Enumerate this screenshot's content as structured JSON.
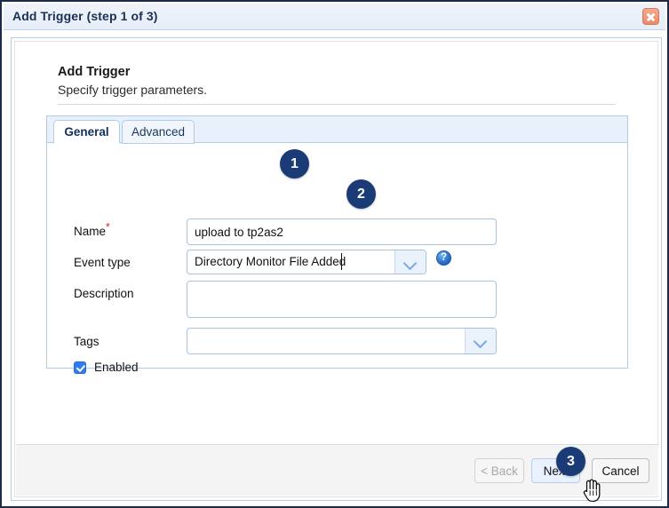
{
  "window": {
    "title": "Add Trigger (step 1 of 3)",
    "close_icon": "close-icon"
  },
  "page": {
    "heading": "Add Trigger",
    "subheading": "Specify trigger parameters."
  },
  "tabs": [
    {
      "label": "General",
      "active": true
    },
    {
      "label": "Advanced",
      "active": false
    }
  ],
  "form": {
    "name": {
      "label": "Name",
      "required_marker": "*",
      "value": "upload to tp2as2",
      "placeholder": ""
    },
    "event_type": {
      "label": "Event type",
      "value": "Directory Monitor File Added",
      "placeholder": "",
      "dropdown_icon": "chevron-down-icon",
      "help_icon": "help-icon",
      "help_glyph": "?"
    },
    "description": {
      "label": "Description",
      "value": "",
      "placeholder": ""
    },
    "tags": {
      "label": "Tags",
      "value": "",
      "placeholder": "",
      "dropdown_icon": "chevron-down-icon"
    },
    "enabled": {
      "label": "Enabled",
      "checked": true
    }
  },
  "footer": {
    "back_label": "< Back",
    "back_disabled": true,
    "next_label": "Next",
    "cancel_label": "Cancel"
  },
  "annotations": [
    {
      "number": "1",
      "target": "name-input"
    },
    {
      "number": "2",
      "target": "event-type-combo"
    },
    {
      "number": "3",
      "target": "next-button"
    }
  ],
  "colors": {
    "dialog_border": "#1b2a4a",
    "title_text": "#1c3054",
    "close_button": "#e98b6b",
    "badge": "#1b3b77",
    "accent_blue": "#2f7df4",
    "required_star": "#d2232a",
    "field_border": "#a9c3de",
    "tab_strip": "#e8f0fb"
  }
}
